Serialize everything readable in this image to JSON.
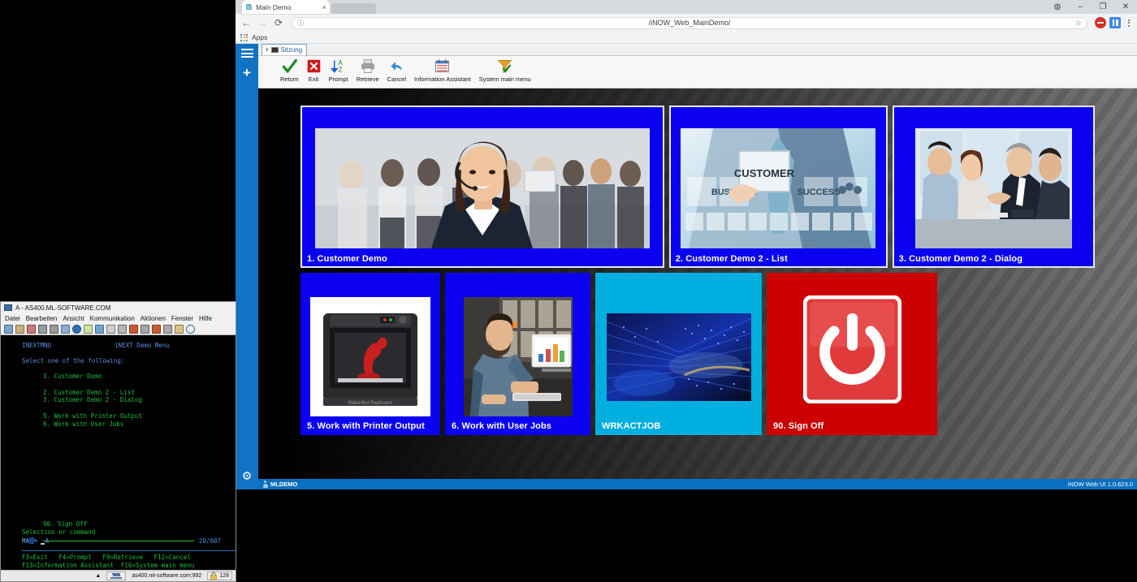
{
  "browser": {
    "tab": {
      "title": "Main Demo",
      "favicon": "page-icon",
      "close": "×"
    },
    "nav": {
      "back": "←",
      "forward": "→",
      "reload": "⟳"
    },
    "omnibox": {
      "url": "/iNOW_Web_MainDemo/",
      "info_icon": "ⓘ",
      "star_icon": "☆"
    },
    "window": {
      "profile": "◍",
      "minimize": "–",
      "maximize": "❐",
      "close": "✕"
    },
    "bookmarks": {
      "apps_label": "Apps"
    }
  },
  "webapp": {
    "sidebar": {
      "menu": "hamburger-icon",
      "add": "+",
      "settings": "gear-icon"
    },
    "session_tab": {
      "close": "x",
      "label": "Sitzung"
    },
    "toolbar": [
      {
        "label": "Return",
        "icon": "check-icon"
      },
      {
        "label": "Exit",
        "icon": "exit-x-icon"
      },
      {
        "label": "Prompt",
        "icon": "sort-az-icon"
      },
      {
        "label": "Retrieve",
        "icon": "printer-icon"
      },
      {
        "label": "Cancel",
        "icon": "undo-arrow-icon"
      },
      {
        "label": "Information Assistant",
        "icon": "calendar-icon"
      },
      {
        "label": "System main menu",
        "icon": "funnel-icon"
      }
    ],
    "tiles_row1": [
      {
        "label": "1. Customer Demo",
        "color": "#0b00f0",
        "image": "call-center-woman",
        "selected": true
      },
      {
        "label": "2. Customer Demo 2 - List",
        "color": "#0b00f0",
        "image": "customer-touchscreen",
        "selected": true
      },
      {
        "label": "3. Customer Demo 2 - Dialog",
        "color": "#0b00f0",
        "image": "business-handshake",
        "selected": true
      }
    ],
    "tiles_row2": [
      {
        "label": "5. Work with Printer Output",
        "color": "#0b00f0",
        "image": "3d-printer",
        "selected": false
      },
      {
        "label": "6. Work with User Jobs",
        "color": "#0b00f0",
        "image": "man-at-computer",
        "selected": false
      },
      {
        "label": "WRKACTJOB",
        "color": "#00aee0",
        "image": "data-center-blue",
        "selected": false
      },
      {
        "label": "90. Sign Off",
        "color": "#cc0000",
        "image": "power-button",
        "selected": false
      }
    ],
    "statusbar": {
      "user": "MLDEMO",
      "version": "iNOW Web UI 1.0.623.0"
    }
  },
  "terminal": {
    "title": "A - AS400.ML-SOFTWARE.COM",
    "menus": [
      "Datei",
      "Bearbeiten",
      "Ansicht",
      "Kommunikation",
      "Aktionen",
      "Fenster",
      "Hilfe"
    ],
    "screen": {
      "line1_left": "INEXTMNU",
      "line1_right": "iNEXT Demo Menu",
      "line2": "Select one of the following:",
      "options": [
        "1. Customer Demo",
        "",
        "2. Customer Demo 2 - List",
        "3. Customer Demo 2 - Dialog",
        "",
        "5. Work with Printer Output",
        "6. Work with User Jobs"
      ],
      "signoff": "90. Sign Off",
      "selection_label": "Selection or command",
      "prompt": "===>",
      "fkeys_line1": "F3=Exit   F4=Prompt   F9=Retrieve   F12=Cancel",
      "fkeys_line2": "F13=Information Assistant  F16=System main menu",
      "oia_left": "MA",
      "oia_mid": "+",
      "oia_right": "A",
      "position": "20/007"
    },
    "statusbar": {
      "host": "as400.ml-software.com:992",
      "encoding": "128",
      "arrow": "▲"
    }
  }
}
